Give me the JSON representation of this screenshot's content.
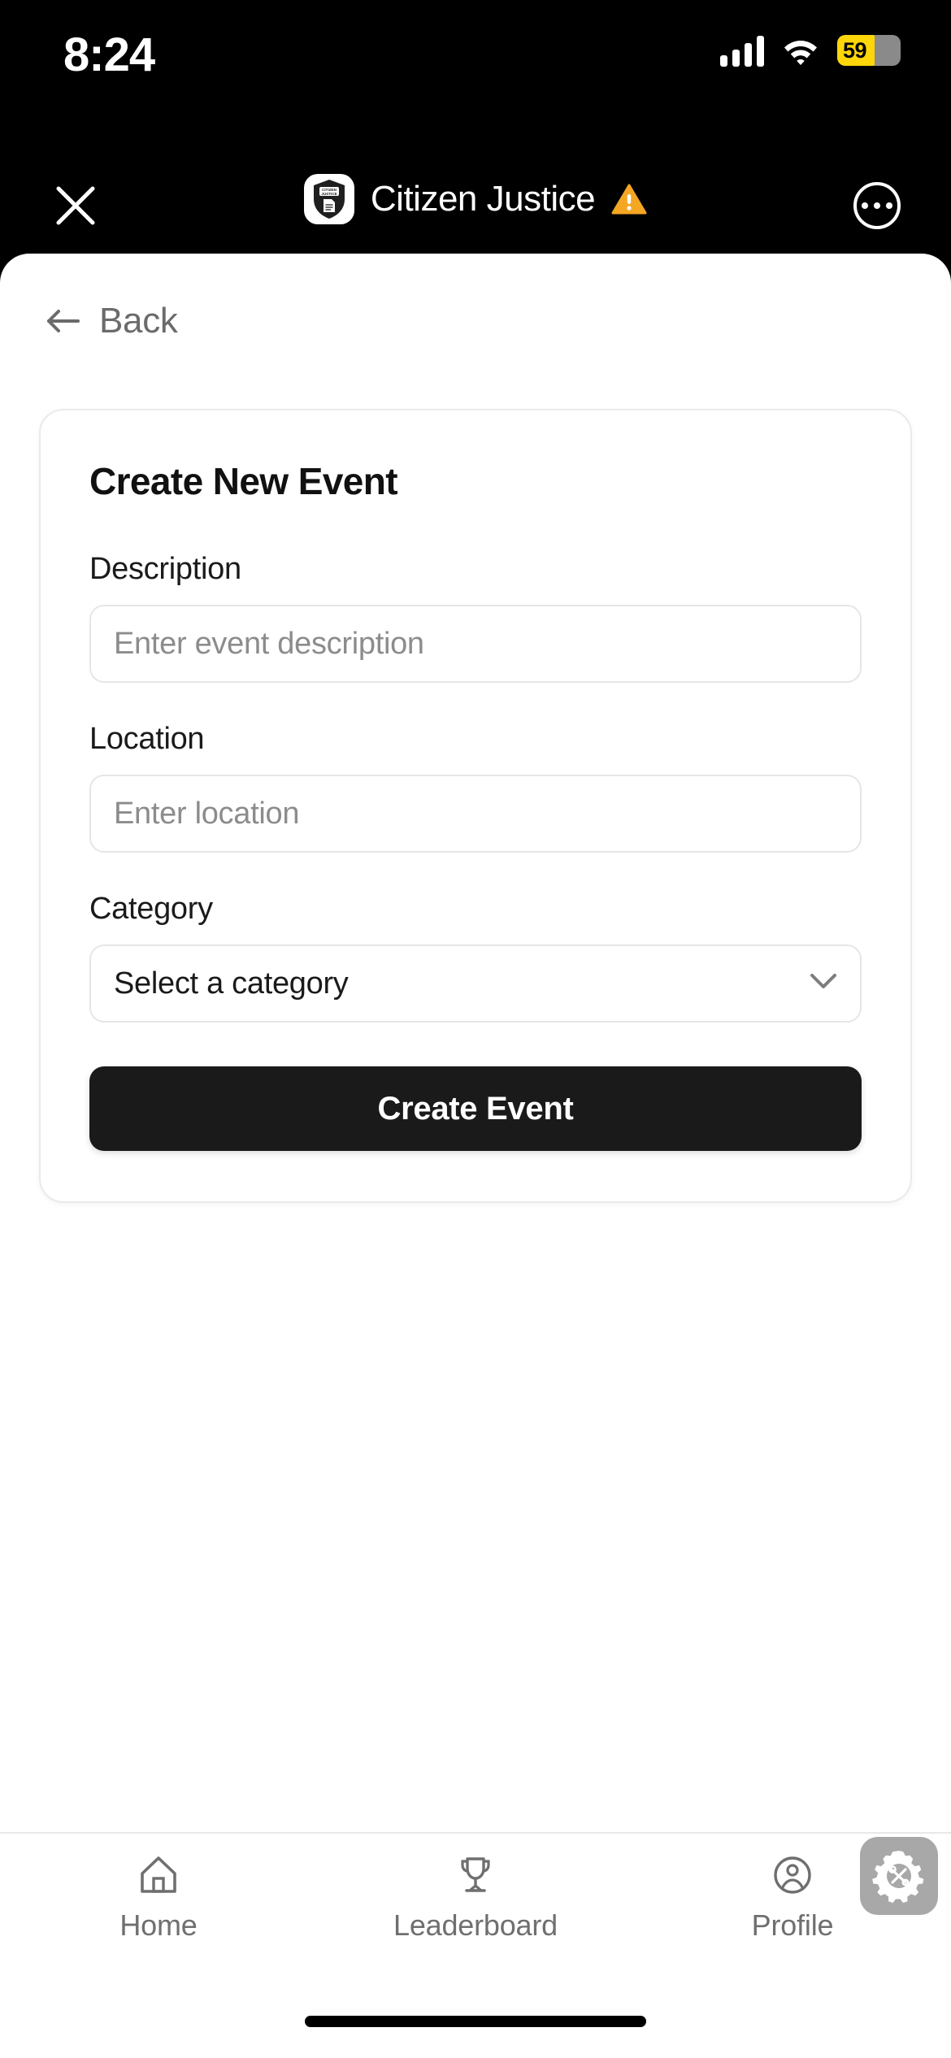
{
  "status_bar": {
    "time": "8:24",
    "signal_icon": "cellular-signal-icon",
    "wifi_icon": "wifi-icon",
    "battery_percent": "59",
    "battery_icon": "battery-low-power-icon"
  },
  "app_bar": {
    "close_icon": "close-icon",
    "app_icon": "citizen-justice-badge-icon",
    "app_icon_text_line1": "CITIZEN",
    "app_icon_text_line2": "JUSTICE",
    "title": "Citizen Justice",
    "warning_icon": "warning-triangle-icon",
    "more_icon": "more-options-icon"
  },
  "nav": {
    "back_label": "Back",
    "back_icon": "arrow-left-icon"
  },
  "form": {
    "card_title": "Create New Event",
    "fields": [
      {
        "label": "Description",
        "placeholder": "Enter event description",
        "value": ""
      },
      {
        "label": "Location",
        "placeholder": "Enter location",
        "value": ""
      }
    ],
    "category": {
      "label": "Category",
      "selected": "Select a category",
      "chevron_icon": "chevron-down-icon"
    },
    "submit_label": "Create Event"
  },
  "tab_bar": {
    "tabs": [
      {
        "label": "Home",
        "icon": "home-icon"
      },
      {
        "label": "Leaderboard",
        "icon": "trophy-icon"
      },
      {
        "label": "Profile",
        "icon": "user-circle-icon"
      }
    ]
  },
  "dev_fab": {
    "icon": "gear-tools-icon"
  },
  "colors": {
    "background": "#000000",
    "sheet": "#ffffff",
    "accent_dark": "#1a1a1a",
    "warning": "#f5a623",
    "battery_yellow": "#ffd60a",
    "muted_text": "#6f6f6f",
    "border": "#e6e6e6"
  }
}
